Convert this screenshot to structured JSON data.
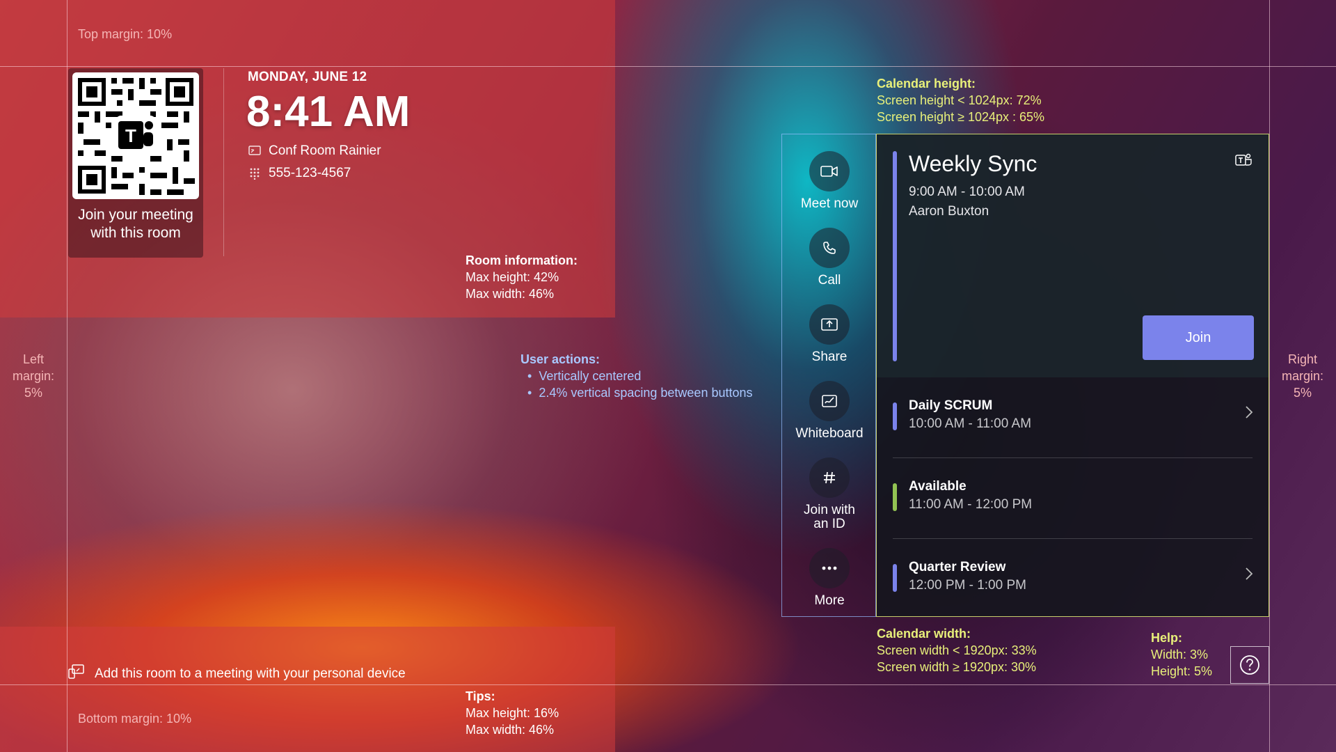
{
  "annotations": {
    "top_margin": "Top margin: 10%",
    "bottom_margin": "Bottom margin: 10%",
    "left_margin": [
      "Left",
      "margin:",
      "5%"
    ],
    "right_margin": [
      "Right",
      "margin:",
      "5%"
    ],
    "room_info": {
      "title": "Room information:",
      "line1": "Max height: 42%",
      "line2": "Max width: 46%"
    },
    "user_actions": {
      "title": "User actions:",
      "line1": "Vertically centered",
      "line2": "2.4% vertical spacing between buttons"
    },
    "calendar_height": {
      "title": "Calendar height:",
      "line1": "Screen height < 1024px: 72%",
      "line2": "Screen height ≥ 1024px : 65%"
    },
    "calendar_width": {
      "title": "Calendar width:",
      "line1": "Screen width < 1920px: 33%",
      "line2": "Screen width ≥ 1920px: 30%"
    },
    "help": {
      "title": "Help:",
      "line1": "Width: 3%",
      "line2": "Height: 5%"
    },
    "tips": {
      "title": "Tips:",
      "line1": "Max height: 16%",
      "line2": "Max width: 46%"
    }
  },
  "room": {
    "qr_caption_1": "Join your meeting",
    "qr_caption_2": "with this room",
    "date": "MONDAY, JUNE 12",
    "time": "8:41 AM",
    "name": "Conf Room Rainier",
    "phone": "555-123-4567"
  },
  "actions": [
    {
      "label": "Meet now",
      "icon": "video-camera-icon"
    },
    {
      "label": "Call",
      "icon": "phone-icon"
    },
    {
      "label": "Share",
      "icon": "share-screen-icon"
    },
    {
      "label": "Whiteboard",
      "icon": "whiteboard-icon"
    },
    {
      "label_1": "Join with",
      "label_2": "an ID",
      "icon": "hash-icon"
    },
    {
      "label": "More",
      "icon": "more-icon"
    }
  ],
  "calendar": {
    "current": {
      "title": "Weekly Sync",
      "time": "9:00 AM - 10:00 AM",
      "organizer": "Aaron Buxton",
      "join_label": "Join"
    },
    "items": [
      {
        "title": "Daily SCRUM",
        "time": "10:00 AM - 11:00 AM",
        "color": "#7b83eb"
      },
      {
        "title": "Available",
        "time": "11:00 AM - 12:00 PM",
        "color": "#92c353"
      },
      {
        "title": "Quarter Review",
        "time": "12:00 PM - 1:00 PM",
        "color": "#7b83eb"
      }
    ]
  },
  "tip": {
    "text": "Add this room to a meeting with your personal device"
  },
  "colors": {
    "accent": "#7b83eb",
    "available": "#92c353"
  }
}
